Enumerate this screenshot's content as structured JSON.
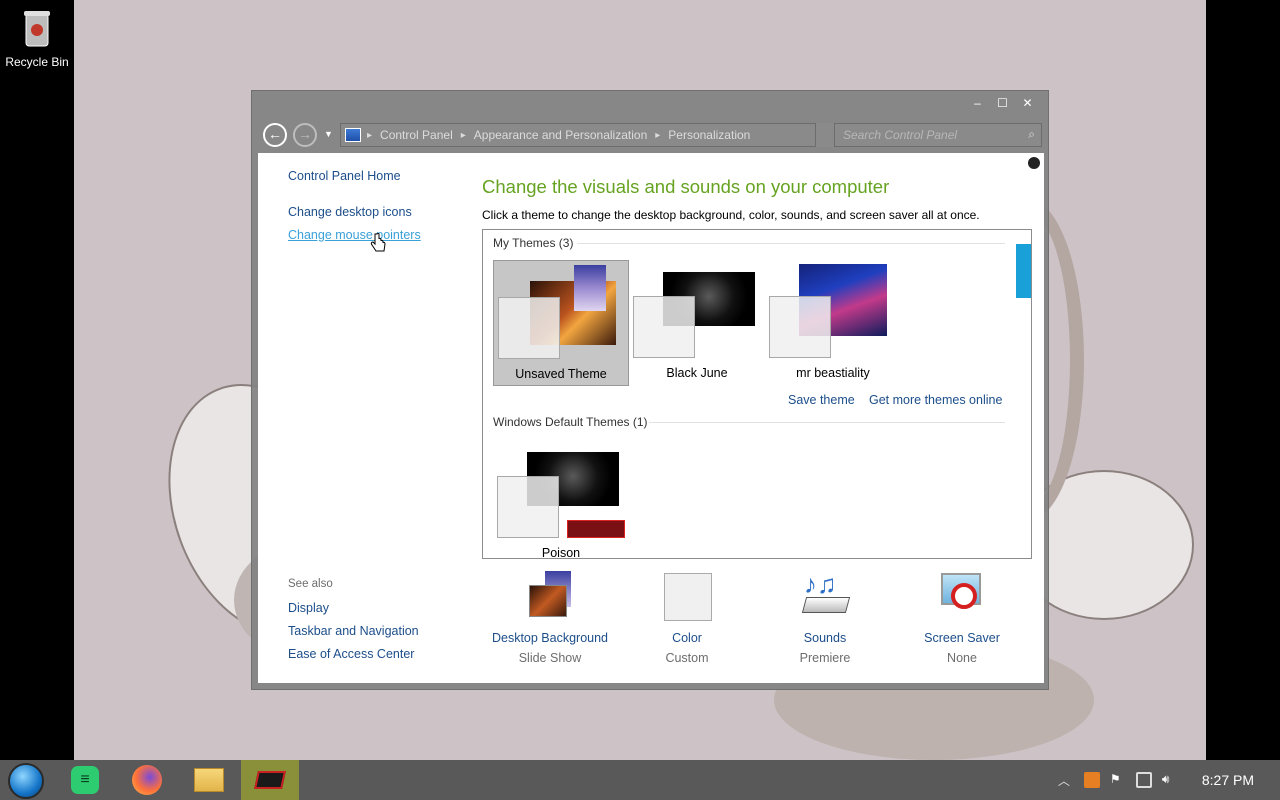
{
  "desktop": {
    "icons": [
      {
        "label": "Recycle Bin"
      }
    ]
  },
  "window": {
    "controls": {
      "minimize": "–",
      "maximize": "☐",
      "close": "✕"
    },
    "address": {
      "breadcrumbs": [
        "Control Panel",
        "Appearance and Personalization",
        "Personalization"
      ]
    },
    "search": {
      "placeholder": "Search Control Panel"
    },
    "sidebar": {
      "home": "Control Panel Home",
      "links": [
        "Change desktop icons",
        "Change mouse pointers"
      ],
      "see_also_label": "See also",
      "see_also": [
        "Display",
        "Taskbar and Navigation",
        "Ease of Access Center"
      ]
    },
    "main": {
      "title": "Change the visuals and sounds on your computer",
      "subtitle": "Click a theme to change the desktop background, color, sounds, and screen saver all at once.",
      "groups": [
        {
          "title": "My Themes (3)",
          "themes": [
            {
              "name": "Unsaved Theme",
              "selected": true
            },
            {
              "name": "Black June",
              "selected": false
            },
            {
              "name": "mr beastiality",
              "selected": false
            }
          ],
          "links": [
            "Save theme",
            "Get more themes online"
          ]
        },
        {
          "title": "Windows Default Themes (1)",
          "themes": [
            {
              "name": "Poison",
              "selected": false
            }
          ]
        }
      ],
      "bottom": [
        {
          "label": "Desktop Background",
          "value": "Slide Show",
          "icon": "desktop-background-icon"
        },
        {
          "label": "Color",
          "value": "Custom",
          "icon": "color-swatch-icon"
        },
        {
          "label": "Sounds",
          "value": "Premiere",
          "icon": "sounds-icon"
        },
        {
          "label": "Screen Saver",
          "value": "None",
          "icon": "screen-saver-icon"
        }
      ]
    }
  },
  "taskbar": {
    "apps": [
      "start-orb",
      "notes-app",
      "firefox",
      "file-explorer",
      "graphics-app"
    ],
    "clock": "8:27 PM",
    "colors": {
      "accent": "#1aa0d8",
      "heading": "#66a321",
      "link": "#1c4e8a"
    }
  }
}
